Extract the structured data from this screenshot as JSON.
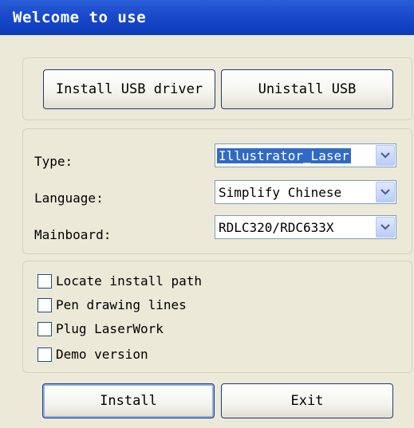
{
  "window": {
    "title": "Welcome to use"
  },
  "usb": {
    "install_label": "Install USB driver",
    "uninstall_label": "Unistall USB"
  },
  "settings": {
    "type_label": "Type:",
    "type_value": "Illustrator_Laser",
    "language_label": "Language:",
    "language_value": "Simplify Chinese",
    "mainboard_label": "Mainboard:",
    "mainboard_value": "RDLC320/RDC633X"
  },
  "options": [
    {
      "label": "Locate install path",
      "checked": false
    },
    {
      "label": "Pen drawing lines",
      "checked": false
    },
    {
      "label": "Plug LaserWork",
      "checked": false
    },
    {
      "label": "Demo version",
      "checked": false
    }
  ],
  "actions": {
    "install_label": "Install",
    "exit_label": "Exit"
  },
  "icons": {
    "dropdown": "chevron-down-icon"
  },
  "colors": {
    "titlebar": "#0b3bbb",
    "selection": "#316ac5",
    "dialog_bg": "#ece9d8"
  }
}
